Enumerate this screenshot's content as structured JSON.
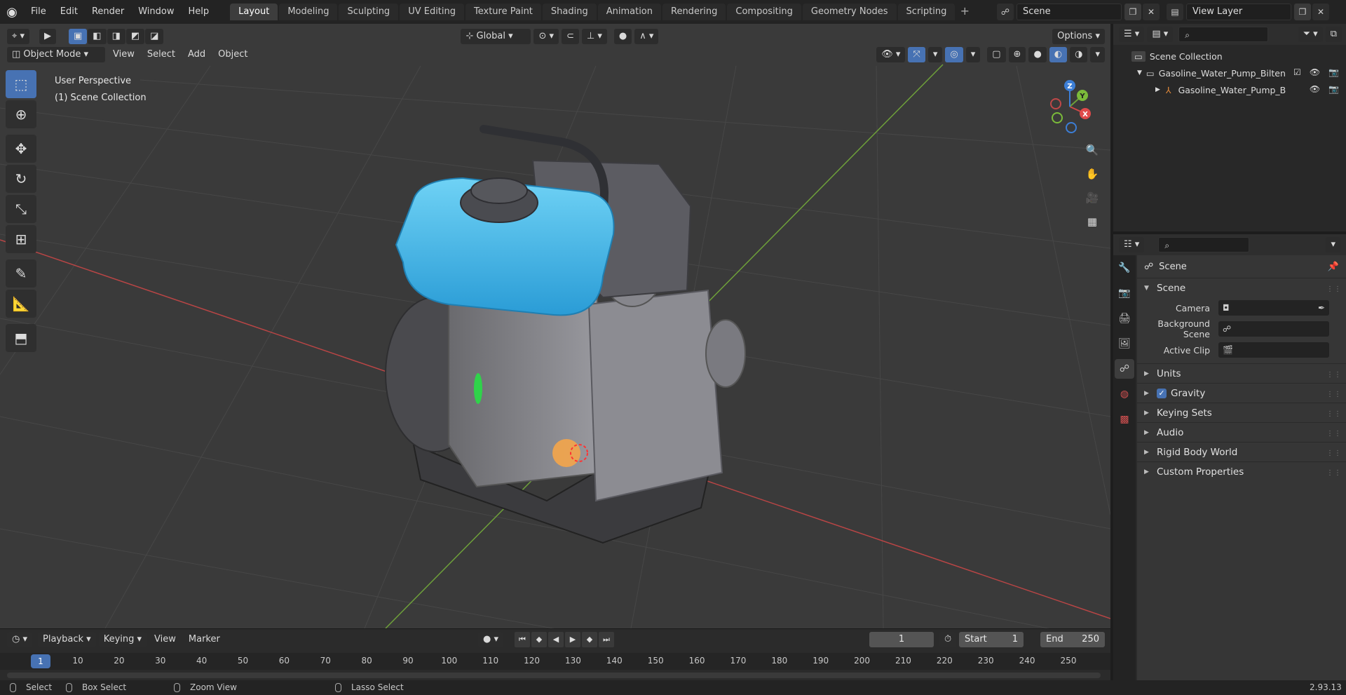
{
  "menu": {
    "items": [
      "File",
      "Edit",
      "Render",
      "Window",
      "Help"
    ]
  },
  "workspaces": {
    "tabs": [
      "Layout",
      "Modeling",
      "Sculpting",
      "UV Editing",
      "Texture Paint",
      "Shading",
      "Animation",
      "Rendering",
      "Compositing",
      "Geometry Nodes",
      "Scripting"
    ],
    "active": "Layout",
    "add_label": "+"
  },
  "scene_selector": {
    "value": "Scene"
  },
  "viewlayer_selector": {
    "value": "View Layer"
  },
  "viewport": {
    "mode": "Object Mode",
    "menus": [
      "View",
      "Select",
      "Add",
      "Object"
    ],
    "transform_orientation": "Global",
    "options_label": "Options",
    "perspective_label": "User Perspective",
    "collection_label": "(1) Scene Collection",
    "axis_labels": {
      "x": "X",
      "y": "Y",
      "z": "Z"
    }
  },
  "outliner": {
    "root": "Scene Collection",
    "items": [
      {
        "label": "Gasoline_Water_Pump_Bilten",
        "level": 1,
        "type": "collection"
      },
      {
        "label": "Gasoline_Water_Pump_B",
        "level": 2,
        "type": "object"
      }
    ]
  },
  "properties": {
    "context_title": "Scene",
    "panel_title": "Scene",
    "rows": [
      {
        "label": "Camera"
      },
      {
        "label": "Background Scene"
      },
      {
        "label": "Active Clip"
      }
    ],
    "sections": [
      "Units",
      "Gravity",
      "Keying Sets",
      "Audio",
      "Rigid Body World",
      "Custom Properties"
    ],
    "gravity_checked": true
  },
  "timeline": {
    "menus": [
      "Playback",
      "Keying",
      "View",
      "Marker"
    ],
    "current_frame": "1",
    "start_label": "Start",
    "start_value": "1",
    "end_label": "End",
    "end_value": "250",
    "ticks": [
      "1",
      "10",
      "20",
      "30",
      "40",
      "50",
      "60",
      "70",
      "80",
      "90",
      "100",
      "110",
      "120",
      "130",
      "140",
      "150",
      "160",
      "170",
      "180",
      "190",
      "200",
      "210",
      "220",
      "230",
      "240",
      "250"
    ]
  },
  "statusbar": {
    "items": [
      "Select",
      "Box Select",
      "Zoom View",
      "Lasso Select"
    ],
    "version": "2.93.13"
  },
  "colors": {
    "accent": "#4772b3",
    "tank": "#3fb8ea",
    "x_axis": "#c04848",
    "y_axis": "#6ea03a"
  }
}
